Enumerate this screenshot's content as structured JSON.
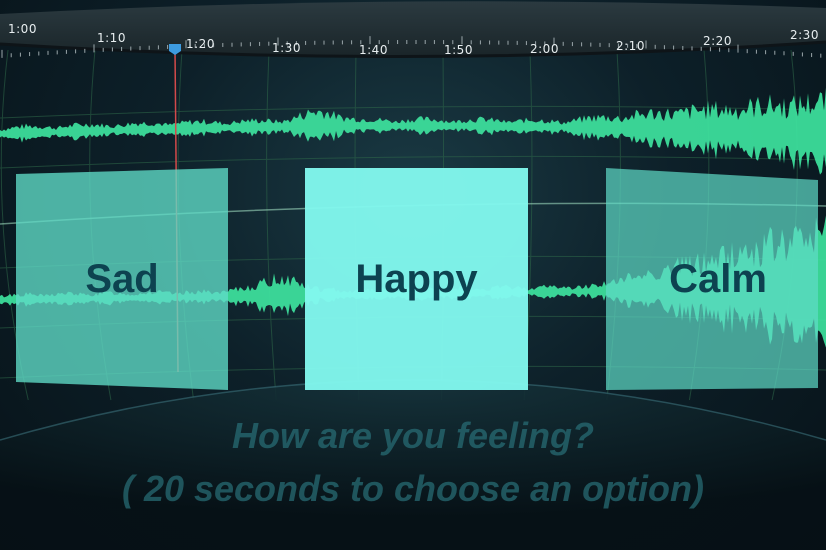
{
  "timeline": {
    "ticks": [
      "1:00",
      "1:10",
      "1:20",
      "1:30",
      "1:40",
      "1:50",
      "2:00",
      "2:10",
      "2:20",
      "2:30"
    ],
    "playhead_time": "1:16"
  },
  "options": [
    {
      "label": "Sad"
    },
    {
      "label": "Happy"
    },
    {
      "label": "Calm"
    }
  ],
  "selected_option": "Happy",
  "prompt": {
    "question": "How are you feeling?",
    "timer": "( 20 seconds to choose an option)"
  },
  "colors": {
    "waveform": "#3ee39e",
    "card": "#60dcc8",
    "card_selected": "#82f8ee",
    "label_text": "#0d4250",
    "playhead": "#d34a4a",
    "playhead_marker": "#3d9be0"
  }
}
